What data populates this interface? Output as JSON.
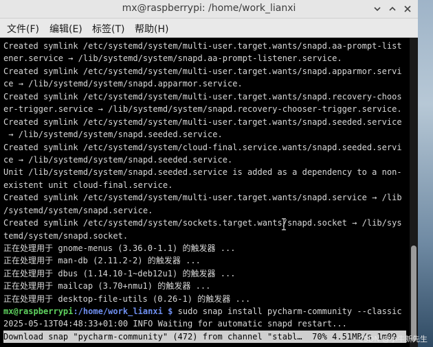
{
  "window": {
    "title": "mx@raspberrypi: /home/work_lianxi"
  },
  "menu": {
    "file": "文件(F)",
    "edit": "编辑(E)",
    "tabs": "标签(T)",
    "help": "帮助(H)"
  },
  "terminal": {
    "lines": [
      "Created symlink /etc/systemd/system/multi-user.target.wants/snapd.aa-prompt-list",
      "ener.service → /lib/systemd/system/snapd.aa-prompt-listener.service.",
      "Created symlink /etc/systemd/system/multi-user.target.wants/snapd.apparmor.servi",
      "ce → /lib/systemd/system/snapd.apparmor.service.",
      "Created symlink /etc/systemd/system/multi-user.target.wants/snapd.recovery-choos",
      "er-trigger.service → /lib/systemd/system/snapd.recovery-chooser-trigger.service.",
      "Created symlink /etc/systemd/system/multi-user.target.wants/snapd.seeded.service",
      " → /lib/systemd/system/snapd.seeded.service.",
      "Created symlink /etc/systemd/system/cloud-final.service.wants/snapd.seeded.servi",
      "ce → /lib/systemd/system/snapd.seeded.service.",
      "Unit /lib/systemd/system/snapd.seeded.service is added as a dependency to a non-",
      "existent unit cloud-final.service.",
      "Created symlink /etc/systemd/system/multi-user.target.wants/snapd.service → /lib",
      "/systemd/system/snapd.service.",
      "Created symlink /etc/systemd/system/sockets.target.wants/snapd.socket → /lib/sys",
      "temd/system/snapd.socket.",
      "正在处理用于 gnome-menus (3.36.0-1.1) 的触发器 ...",
      "正在处理用于 man-db (2.11.2-2) 的触发器 ...",
      "正在处理用于 dbus (1.14.10-1~deb12u1) 的触发器 ...",
      "正在处理用于 mailcap (3.70+nmu1) 的触发器 ...",
      "正在处理用于 desktop-file-utils (0.26-1) 的触发器 ..."
    ],
    "prompt_user": "mx@raspberrypi",
    "prompt_path": ":/home/work_lianxi $",
    "command": " sudo snap install pycharm-community --classic",
    "info_line": "2025-05-13T04:48:33+01:00 INFO Waiting for automatic snapd restart...",
    "progress_line": "Download snap \"pycharm-community\" (472) from channel \"stabl…  70% 4.51MB/s 1m09"
  },
  "watermark": "CSDN @小牛新先生",
  "icons": {
    "minimize": "minimize-icon",
    "maximize": "maximize-icon",
    "close": "close-icon",
    "cursor": "text-cursor-icon"
  },
  "colors": {
    "prompt_user": "#5fd35f",
    "prompt_path": "#6f8ff0",
    "terminal_bg": "#000000",
    "progress_bg": "#cfcfcf"
  }
}
